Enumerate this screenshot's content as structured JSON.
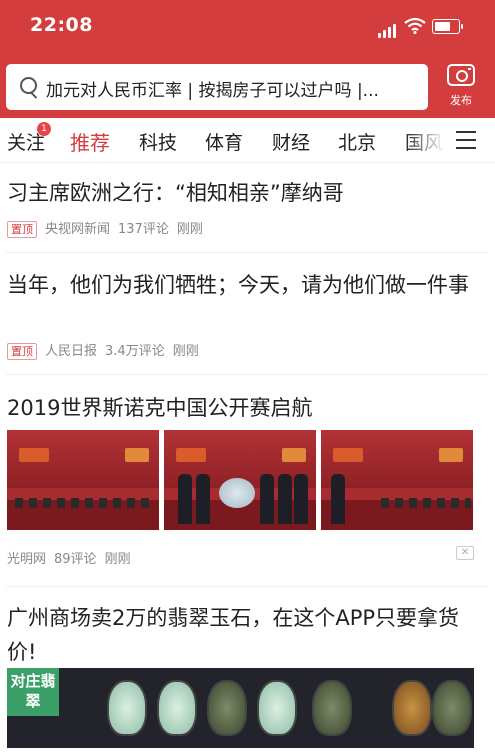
{
  "status_bar": {
    "time": "22:08"
  },
  "search": {
    "query": "加元对人民币汇率 | 按揭房子可以过户吗 |..."
  },
  "post_button": {
    "label": "发布"
  },
  "tabs": [
    {
      "label": "关注",
      "badge": "1"
    },
    {
      "label": "推荐",
      "active": true
    },
    {
      "label": "科技"
    },
    {
      "label": "体育"
    },
    {
      "label": "财经"
    },
    {
      "label": "北京"
    },
    {
      "label": "国风"
    }
  ],
  "articles": [
    {
      "title": "习主席欧洲之行：“相知相亲”摩纳哥",
      "pin": "置顶",
      "source": "央视网新闻",
      "comments": "137评论",
      "time": "刚刚"
    },
    {
      "title": "当年，他们为我们牺牲；今天，请为他们做一件事",
      "pin": "置顶",
      "source": "人民日报",
      "comments": "3.4万评论",
      "time": "刚刚"
    },
    {
      "title": "2019世界斯诺克中国公开赛启航",
      "source": "光明网",
      "comments": "89评论",
      "time": "刚刚"
    },
    {
      "title": "广州商场卖2万的翡翠玉石，在这个APP只要拿货价!",
      "image_badge": "对庄翡翠"
    }
  ],
  "colors": {
    "brand_red": "#d43d3d",
    "text": "#222222",
    "meta": "#888888"
  }
}
